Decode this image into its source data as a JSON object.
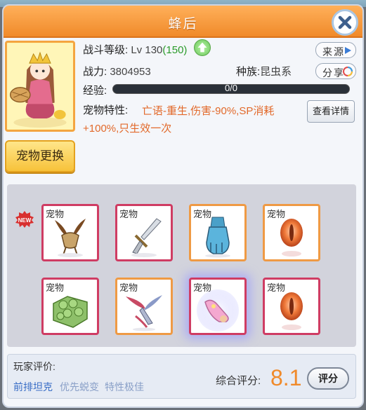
{
  "window": {
    "title": "蜂后"
  },
  "pet": {
    "level_label": "战斗等级:",
    "level_prefix": "Lv 130",
    "level_bonus": "(150)",
    "power_label": "战力:",
    "power_value": "3804953",
    "race_label": "种族:",
    "race_value": "昆虫系",
    "exp_label": "经验:",
    "exp_text": "0/0",
    "exp_fraction": 0,
    "trait_label": "宠物特性:",
    "trait_text": "亡语-重生,伤害-90%,SP消耗+100%,只生效一次"
  },
  "buttons": {
    "source": "来源",
    "share": "分享",
    "details": "查看详情",
    "swap_pet": "宠物更换",
    "rate": "评分",
    "close_icon": "close-icon"
  },
  "equipment": {
    "new_badge": "NEW",
    "slots": [
      {
        "label": "宠物",
        "icon": "horned-helmet-icon",
        "rarity": "red"
      },
      {
        "label": "宠物",
        "icon": "sword-icon",
        "rarity": "red"
      },
      {
        "label": "宠物",
        "icon": "gauntlet-icon",
        "rarity": "orange"
      },
      {
        "label": "宠物",
        "icon": "red-orb-icon",
        "rarity": "orange"
      },
      {
        "label": "宠物",
        "icon": "shell-armor-icon",
        "rarity": "red"
      },
      {
        "label": "宠物",
        "icon": "wing-blade-icon",
        "rarity": "orange"
      },
      {
        "label": "宠物",
        "icon": "pink-boot-icon",
        "rarity": "red"
      },
      {
        "label": "宠物",
        "icon": "red-orb-icon",
        "rarity": "red"
      }
    ]
  },
  "footer": {
    "player_review_label": "玩家评价:",
    "tags": [
      "前排坦克",
      "优先蜕变",
      "特性极佳"
    ],
    "score_label": "综合评分:",
    "score_value": "8.1"
  },
  "colors": {
    "title_bar": "#f39a3a",
    "accent_orange": "#e2692a",
    "slot_red": "#cf3c63",
    "slot_orange": "#ef9a44",
    "tag_blue": "#3a6ec6"
  }
}
